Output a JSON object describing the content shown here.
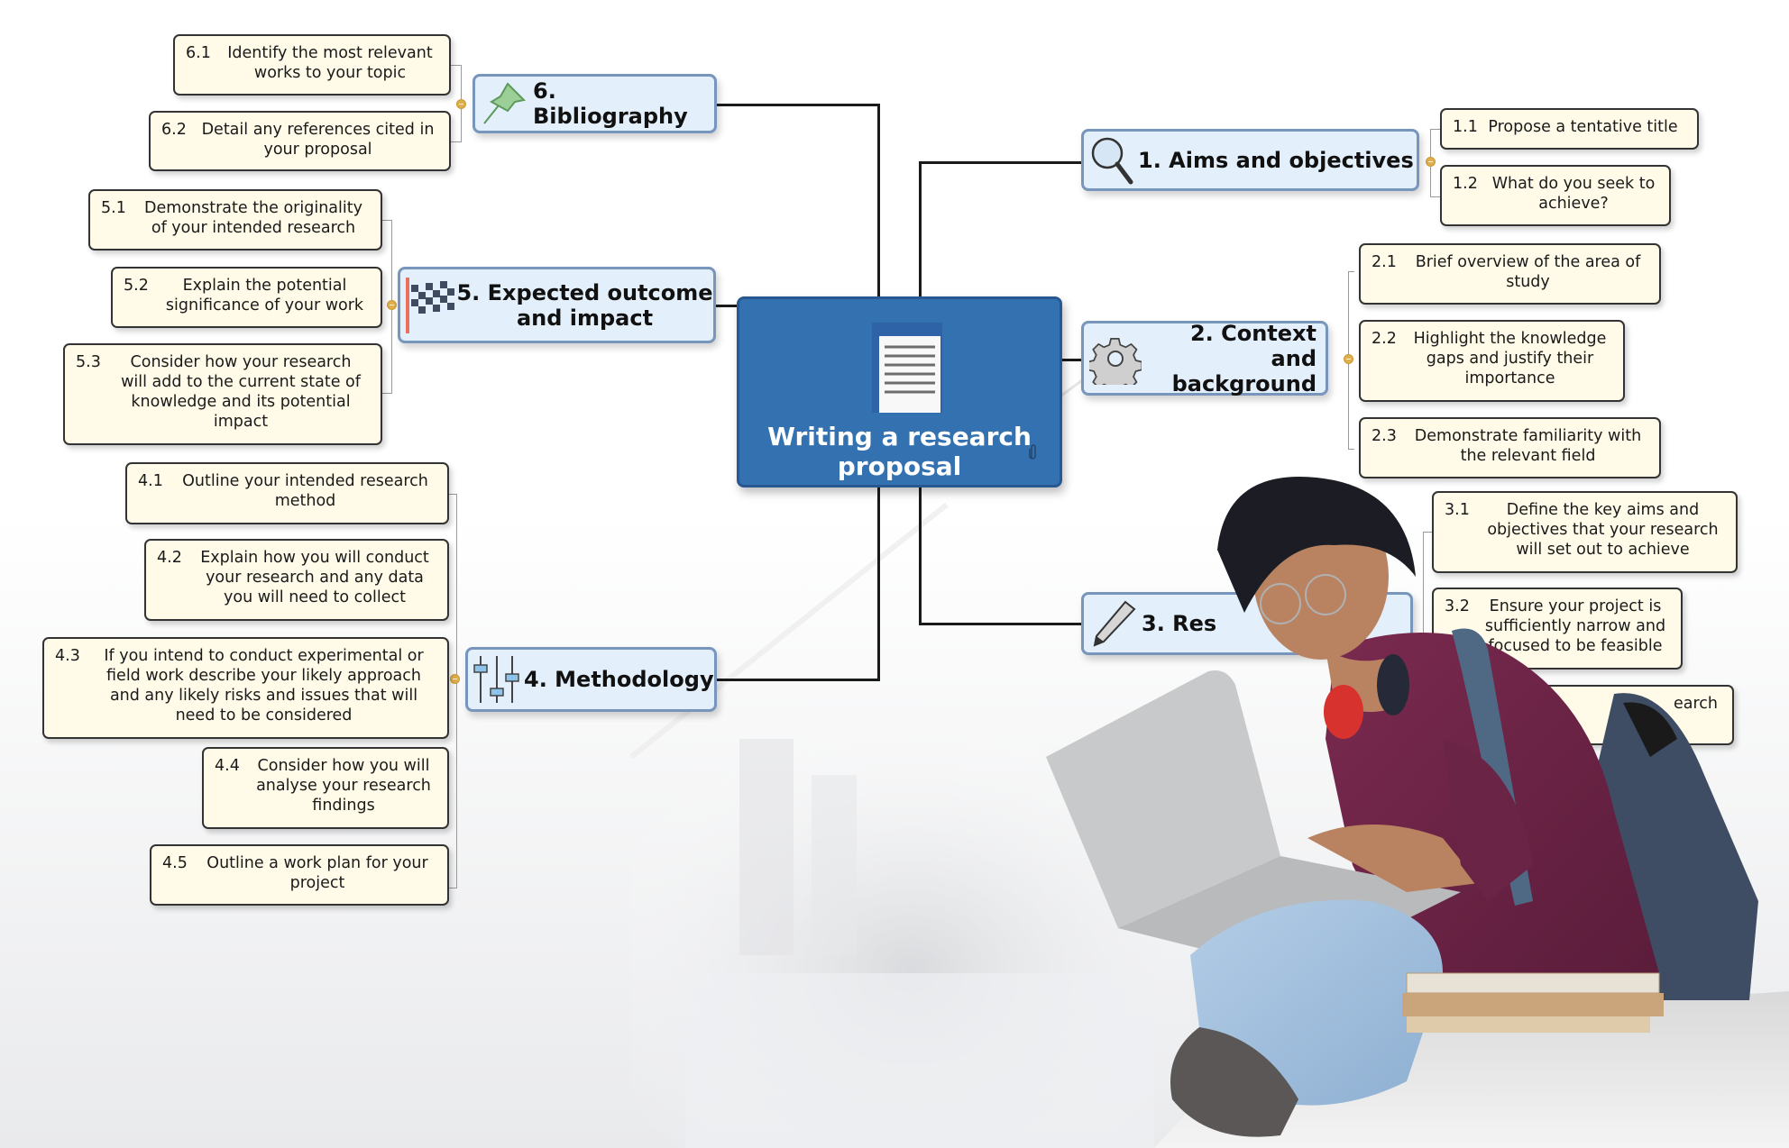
{
  "central": {
    "title": "Writing a research proposal",
    "icon": "document-icon",
    "attachment_icon": "paperclip-icon"
  },
  "colors": {
    "central_fill": "#3371b0",
    "main_fill": "#e3effb",
    "main_border": "#7896bb",
    "sub_fill": "#fffbe8",
    "collapse_dot": "#e0ae4a"
  },
  "branches": [
    {
      "id": "1",
      "num": "1.",
      "label": "Aims and objectives",
      "icon": "magnifier-icon",
      "children": [
        {
          "num": "1.1",
          "text": "Propose a tentative title"
        },
        {
          "num": "1.2",
          "text": "What do you seek to achieve?"
        }
      ]
    },
    {
      "id": "2",
      "num": "2.",
      "label": "Context and background",
      "icon": "gear-icon",
      "children": [
        {
          "num": "2.1",
          "text": "Brief overview of the area of study"
        },
        {
          "num": "2.2",
          "text": "Highlight the knowledge gaps and justify their importance"
        },
        {
          "num": "2.3",
          "text": "Demonstrate familiarity with the relevant field"
        }
      ]
    },
    {
      "id": "3",
      "num": "3.",
      "label": "Res",
      "icon": "pencil-icon",
      "children": [
        {
          "num": "3.1",
          "text": "Define the key aims and objectives that your research will set out to achieve"
        },
        {
          "num": "3.2",
          "text": "Ensure your project is ...ficiently narrow and ...d to be feasible"
        },
        {
          "num": "",
          "text": "...earch"
        }
      ]
    },
    {
      "id": "4",
      "num": "4.",
      "label": "Methodology",
      "icon": "sliders-icon",
      "children": [
        {
          "num": "4.1",
          "text": "Outline your intended research method"
        },
        {
          "num": "4.2",
          "text": "Explain how you will conduct your research and any data you will need to collect"
        },
        {
          "num": "4.3",
          "text": "If you intend to conduct experimental or field work describe your likely approach and any likely risks and issues that will need to be considered"
        },
        {
          "num": "4.4",
          "text": "Consider how you will analyse your research findings"
        },
        {
          "num": "4.5",
          "text": "Outline a work plan for your project"
        }
      ]
    },
    {
      "id": "5",
      "num": "5.",
      "label": "Expected outcome and impact",
      "icon": "checkered-flag-icon",
      "children": [
        {
          "num": "5.1",
          "text": "Demonstrate the originality of your intended research"
        },
        {
          "num": "5.2",
          "text": "Explain the potential significance of your work"
        },
        {
          "num": "5.3",
          "text": "Consider how your research will add to the current state of knowledge and its potential impact"
        }
      ]
    },
    {
      "id": "6",
      "num": "6.",
      "label": "Bibliography",
      "icon": "pushpin-icon",
      "children": [
        {
          "num": "6.1",
          "text": "Identify the most relevant works to your topic"
        },
        {
          "num": "6.2",
          "text": "Detail any references cited in your proposal"
        }
      ]
    }
  ],
  "display": {
    "b1_title": "1.  Aims and objectives",
    "b2_title_l1": "2.  Context and",
    "b2_title_l2": "background",
    "b3_title": "3.  Res",
    "b4_title": "4.  Methodology",
    "b5_title_l1": "5.  Expected outcome",
    "b5_title_l2": "and impact",
    "b6_title": "6.  Bibliography",
    "c11": "Propose a tentative title",
    "c12_l1": "What do you seek to",
    "c12_l2": "achieve?",
    "c21_l1": "Brief overview of the area of",
    "c21_l2": "study",
    "c22_l1": "Highlight the knowledge",
    "c22_l2": "gaps and justify their",
    "c22_l3": "importance",
    "c23_l1": "Demonstrate familiarity with",
    "c23_l2": "the relevant field",
    "c31_l1": "Define the key aims and",
    "c31_l2": "objectives that your research",
    "c31_l3": "will set out to achieve",
    "c32_l1": "Ensure your project is",
    "c32_l2": "sufficiently narrow and",
    "c32_l3": "focused to be feasible",
    "c33_l1": "earch",
    "c41_l1": "Outline your intended research",
    "c41_l2": "method",
    "c42_l1": "Explain how you will conduct",
    "c42_l2": "your research and any data",
    "c42_l3": "you will need to collect",
    "c43_l1": "If you intend to conduct experimental or",
    "c43_l2": "field work describe your likely approach",
    "c43_l3": "and any likely risks and issues that will",
    "c43_l4": "need to be considered",
    "c44_l1": "Consider how you will",
    "c44_l2": "analyse your research",
    "c44_l3": "findings",
    "c45_l1": "Outline a work plan for your",
    "c45_l2": "project",
    "c51_l1": "Demonstrate the originality",
    "c51_l2": "of your intended research",
    "c52_l1": "Explain the potential",
    "c52_l2": "significance of your work",
    "c53_l1": "Consider how your research",
    "c53_l2": "will add to the current state of",
    "c53_l3": "knowledge and its potential",
    "c53_l4": "impact",
    "c61_l1": "Identify the most relevant",
    "c61_l2": "works to your topic",
    "c62_l1": "Detail any references cited in",
    "c62_l2": "your proposal",
    "central_l1": "Writing a research",
    "central_l2": "proposal"
  }
}
